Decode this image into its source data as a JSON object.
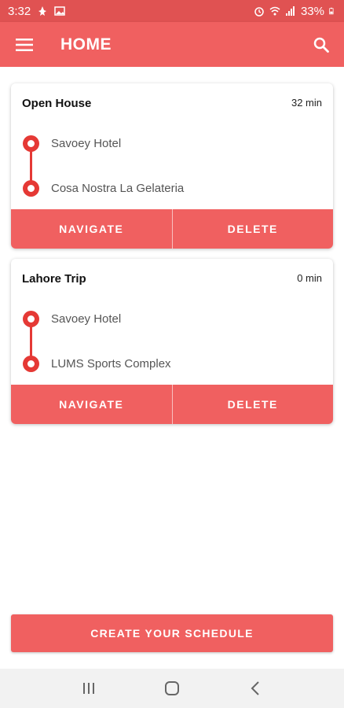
{
  "status_bar": {
    "time": "3:32",
    "battery": "33%"
  },
  "app_bar": {
    "title": "HOME",
    "menu_icon": "hamburger-menu-icon",
    "search_icon": "search-icon"
  },
  "colors": {
    "primary": "#f06060",
    "status": "#e05252",
    "route": "#e53935"
  },
  "trips": [
    {
      "title": "Open House",
      "duration": "32 min",
      "origin": "Savoey Hotel",
      "destination": "Cosa Nostra La Gelateria",
      "navigate_label": "NAVIGATE",
      "delete_label": "DELETE"
    },
    {
      "title": "Lahore Trip",
      "duration": "0 min",
      "origin": "Savoey Hotel",
      "destination": "LUMS Sports Complex",
      "navigate_label": "NAVIGATE",
      "delete_label": "DELETE"
    }
  ],
  "create_button": {
    "label": "CREATE YOUR SCHEDULE"
  },
  "nav_bar": {
    "recents_icon": "recents-icon",
    "home_icon": "home-icon",
    "back_icon": "back-icon"
  }
}
